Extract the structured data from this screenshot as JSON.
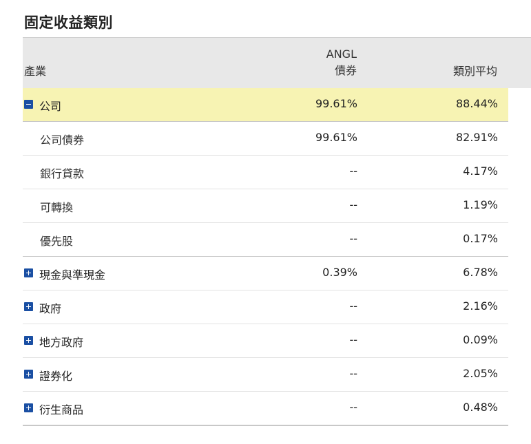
{
  "title": "固定收益類別",
  "header": {
    "industry": "產業",
    "fund_line1": "ANGL",
    "fund_line2": "債券",
    "average": "類別平均"
  },
  "rows": [
    {
      "label": "公司",
      "fund": "99.61%",
      "avg": "88.44%",
      "toggle": "collapse-icon"
    },
    {
      "label": "公司債券",
      "fund": "99.61%",
      "avg": "82.91%"
    },
    {
      "label": "銀行貸款",
      "fund": "--",
      "avg": "4.17%"
    },
    {
      "label": "可轉換",
      "fund": "--",
      "avg": "1.19%"
    },
    {
      "label": "優先股",
      "fund": "--",
      "avg": "0.17%"
    },
    {
      "label": "現金與準現金",
      "fund": "0.39%",
      "avg": "6.78%",
      "toggle": "expand-icon"
    },
    {
      "label": "政府",
      "fund": "--",
      "avg": "2.16%",
      "toggle": "expand-icon"
    },
    {
      "label": "地方政府",
      "fund": "--",
      "avg": "0.09%",
      "toggle": "expand-icon"
    },
    {
      "label": "證券化",
      "fund": "--",
      "avg": "2.05%",
      "toggle": "expand-icon"
    },
    {
      "label": "衍生商品",
      "fund": "--",
      "avg": "0.48%",
      "toggle": "expand-icon"
    }
  ],
  "colors": {
    "highlight": "#f7f3b3",
    "toggle": "#1a4fa3",
    "header_bg": "#e8e8e8"
  }
}
